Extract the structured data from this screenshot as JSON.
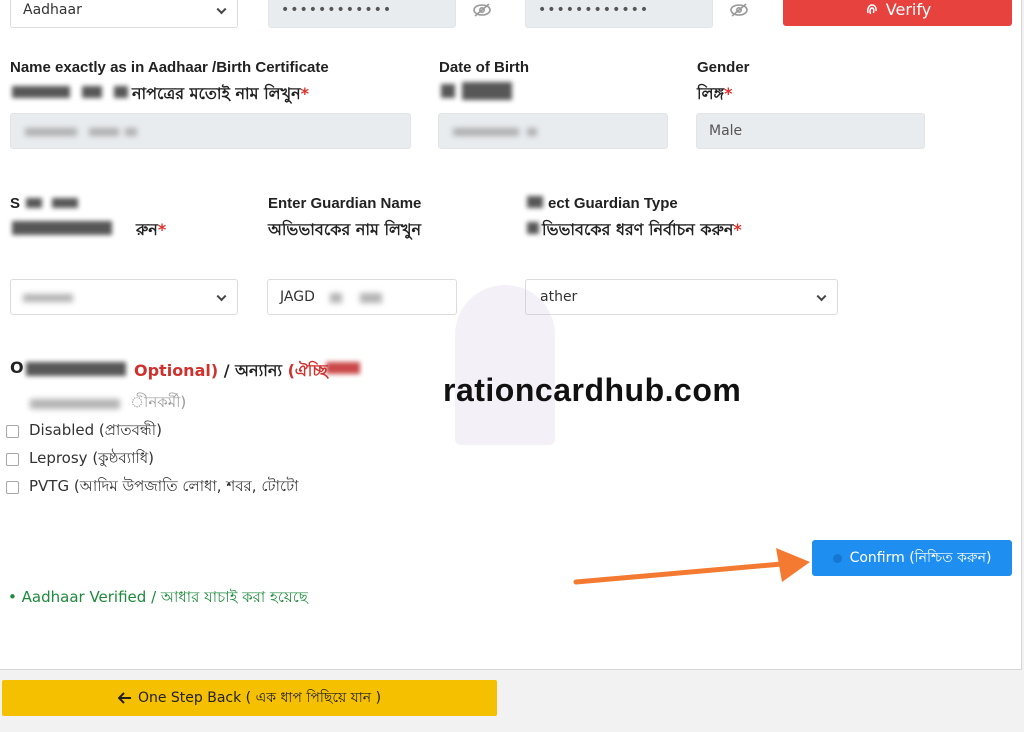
{
  "id_type": {
    "selected": "Aadhaar"
  },
  "masked_fields": {
    "field1": "••••••••••••",
    "field2": "••••••••••••"
  },
  "verify_button": {
    "label": "Verify"
  },
  "name_field": {
    "label_en": "Name exactly as in Aadhaar /Birth Certificate",
    "label_bn_partial": "নাপত্রের মতোই নাম লিখুন"
  },
  "dob_field": {
    "label_en": "Date of Birth"
  },
  "gender_field": {
    "label_en": "Gender",
    "label_bn": "লিঙ্গ",
    "value": "Male"
  },
  "relation_field": {
    "label_en_partial": "S",
    "label_bn_partial": "রুন"
  },
  "guardian_name": {
    "label_en": "Enter Guardian Name",
    "label_bn": "অভিভাবকের নাম লিখুন",
    "value_partial": "JAGD"
  },
  "guardian_type": {
    "label_en_partial": "ect Guardian Type",
    "label_bn_partial": "ভিভাবকের ধরণ নির্বাচন করুন",
    "value_partial": "ather"
  },
  "other_section": {
    "prefix": "O",
    "optional_label": "Optional)",
    "separator": " / অন্যান্য ",
    "bn_optional_partial": "(ঐচ্ছি"
  },
  "checkboxes": [
    {
      "label": "ীনকর্মী)"
    },
    {
      "label": "Disabled (প্রাতবন্ধী)"
    },
    {
      "label": "Leprosy (কুষ্ঠব্যাধি)"
    },
    {
      "label": "PVTG (আদিম উপজাতি লোধা, শবর, টোটো"
    }
  ],
  "watermark": {
    "text": "rationcardhub.com"
  },
  "confirm_button": {
    "label": "Confirm (নিশ্চিত করুন)"
  },
  "status": {
    "text": "Aadhaar Verified / আধার যাচাই করা হয়েছে",
    "bullet": "•"
  },
  "back_button": {
    "label": "One Step Back ( এক ধাপ পিছিয়ে যান )",
    "icon": "arrow-left-icon"
  },
  "colors": {
    "verify": "#e8423f",
    "confirm": "#1f8ef1",
    "back": "#f5c000",
    "verified_text": "#1d8a3b",
    "required": "#e0312b",
    "annotation_arrow": "#f47a32"
  }
}
